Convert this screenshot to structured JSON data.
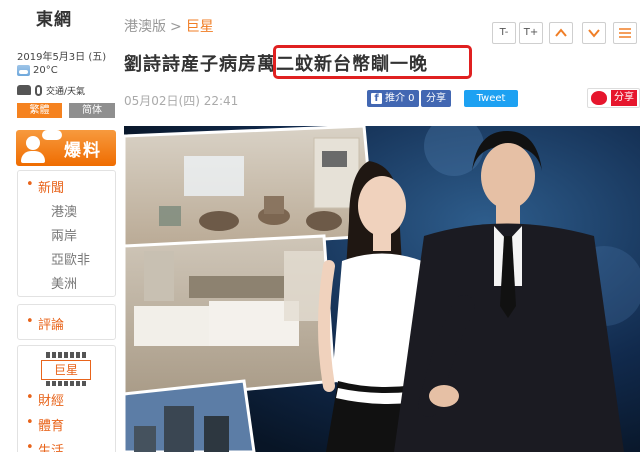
{
  "sidebar": {
    "logo": "東網",
    "date": "2019年5月3日 (五)",
    "weather": {
      "icon": "cloudy-icon",
      "temp": "20°C"
    },
    "traffic": {
      "label": "交通/天氣"
    },
    "lang": {
      "traditional": "繁體",
      "simplified": "简体"
    },
    "baoliao": "爆料",
    "nav_group1": [
      "新聞",
      "港澳",
      "兩岸",
      "亞歐非",
      "美洲"
    ],
    "nav_group2": [
      "評論"
    ],
    "nav_group3": {
      "badge": "巨星",
      "items": [
        "財經",
        "體育",
        "生活"
      ]
    }
  },
  "breadcrumb": {
    "section": "港澳版",
    "separator": ">",
    "current": "巨星"
  },
  "toolbar": {
    "font_smaller": "T-",
    "font_larger": "T+",
    "up": "^",
    "down": "v",
    "more": "≡"
  },
  "article": {
    "headline": "劉詩詩産子病房萬二蚊新台幣瞓一晚",
    "datetime": "05月02日(四) 22:41",
    "share": {
      "fb_like": "推介 0",
      "fb_share": "分享",
      "tweet": "Tweet",
      "weibo_share": "分享"
    }
  },
  "colors": {
    "accent": "#f07e26",
    "highlight_box": "#e02020",
    "facebook": "#4267b2",
    "twitter": "#1da1f2",
    "weibo": "#e6162d"
  }
}
